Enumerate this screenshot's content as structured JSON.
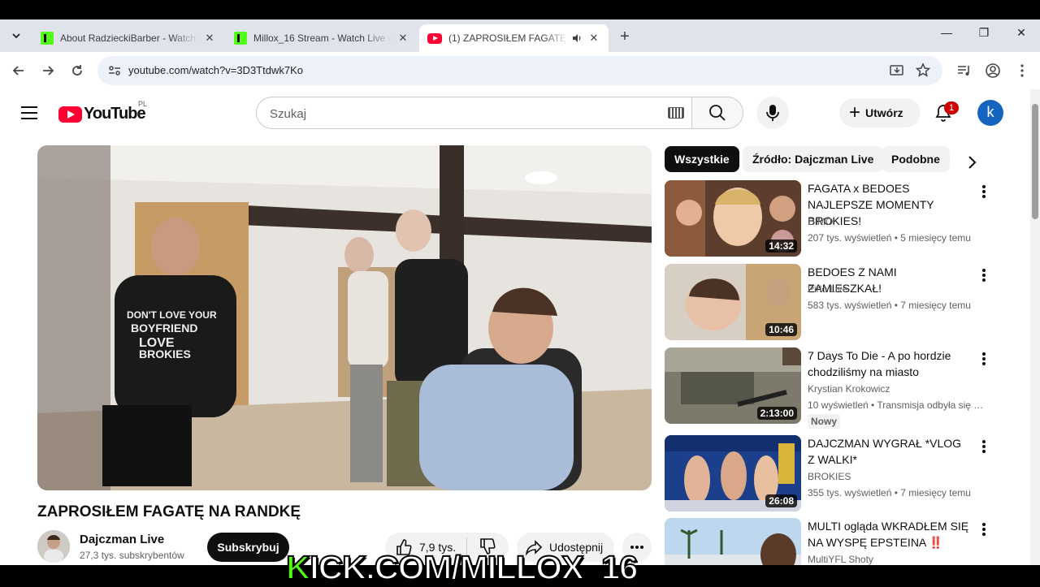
{
  "browser": {
    "tabs": [
      {
        "title": "About RadzieckiBarber - Watch",
        "icon": "kick-favicon"
      },
      {
        "title": "Millox_16 Stream - Watch Live o",
        "icon": "kick-favicon"
      },
      {
        "title": "(1) ZAPROSIŁEM FAGATĘ NA",
        "icon": "youtube-favicon",
        "active": true,
        "audio": true
      }
    ],
    "url": "youtube.com/watch?v=3D3Ttdwk7Ko"
  },
  "youtube": {
    "logo_text": "YouTube",
    "country": "PL",
    "search_placeholder": "Szukaj",
    "create_label": "Utwórz",
    "notifications": "1",
    "avatar_letter": "k"
  },
  "video": {
    "title": "ZAPROSIŁEM FAGATĘ NA RANDKĘ",
    "channel": "Dajczman Live",
    "subscribers": "27,3 tys. subskrybentów",
    "subscribe_label": "Subskrybuj",
    "likes": "7,9 tys.",
    "share_label": "Udostępnij"
  },
  "chips": [
    "Wszystkie",
    "Źródło: Dajczman Live",
    "Podobne"
  ],
  "recommendations": [
    {
      "title": "FAGATA x BEDOES NAJLEPSZE MOMENTY BROKIES!",
      "channel": "DIMO",
      "meta": "207 tys. wyświetleń • 5 miesięcy temu",
      "duration": "14:32"
    },
    {
      "title": "BEDOES Z NAMI ZAMIESZKAŁ!",
      "channel": "Pirlo Live",
      "meta": "583 tys. wyświetleń • 7 miesięcy temu",
      "duration": "10:46"
    },
    {
      "title": "7 Days To Die - A po hordzie chodziliśmy na miasto",
      "channel": "Krystian Krokowicz",
      "meta": "10 wyświetleń • Transmisja odbyła się 1 godzinę temu",
      "duration": "2:13:00",
      "badge": "Nowy"
    },
    {
      "title": "DAJCZMAN WYGRAŁ *VLOG Z WALKI*",
      "channel": "BROKIES",
      "meta": "355 tys. wyświetleń • 7 miesięcy temu",
      "duration": "26:08"
    },
    {
      "title": "MULTI ogląda WKRADŁEM SIĘ NA WYSPĘ EPSTEINA ‼️",
      "channel": "MultiYFL Shoty",
      "meta": "",
      "duration": ""
    }
  ],
  "overlay_text": {
    "k": "K",
    "rest": "ICK.COM/MILLOX_16"
  }
}
